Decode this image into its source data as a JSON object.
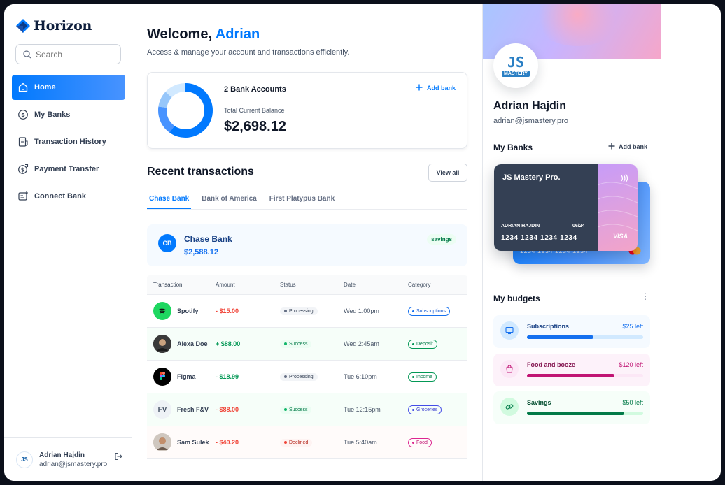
{
  "brand": {
    "name": "Horizon"
  },
  "search": {
    "placeholder": "Search"
  },
  "sidebar": {
    "items": [
      {
        "label": "Home",
        "icon": "home-icon"
      },
      {
        "label": "My Banks",
        "icon": "dollar-circle-icon"
      },
      {
        "label": "Transaction History",
        "icon": "receipt-icon"
      },
      {
        "label": "Payment Transfer",
        "icon": "money-send-icon"
      },
      {
        "label": "Connect Bank",
        "icon": "connect-bank-icon"
      }
    ],
    "user": {
      "name": "Adrian Hajdin",
      "email": "adrian@jsmastery.pro",
      "avatar_text": "JS"
    }
  },
  "header": {
    "greeting": "Welcome,",
    "name": "Adrian",
    "subtitle": "Access & manage your account and transactions efficiently."
  },
  "balance": {
    "accounts_label": "2 Bank Accounts",
    "total_label": "Total Current Balance",
    "total": "$2,698.12",
    "add_bank": "Add bank"
  },
  "recent": {
    "title": "Recent transactions",
    "view_all": "View all",
    "tabs": [
      "Chase Bank",
      "Bank of America",
      "First Platypus Bank"
    ],
    "active_bank": {
      "initials": "CB",
      "name": "Chase Bank",
      "balance": "$2,588.12",
      "type": "savings"
    },
    "columns": [
      "Transaction",
      "Amount",
      "Status",
      "Date",
      "Category"
    ],
    "rows": [
      {
        "name": "Spotify",
        "amount": "- $15.00",
        "status": "Processing",
        "date": "Wed 1:00pm",
        "category": "Subscriptions"
      },
      {
        "name": "Alexa Doe",
        "amount": "+ $88.00",
        "status": "Success",
        "date": "Wed 2:45am",
        "category": "Deposit"
      },
      {
        "name": "Figma",
        "amount": "- $18.99",
        "status": "Processing",
        "date": "Tue 6:10pm",
        "category": "Income"
      },
      {
        "name": "Fresh F&V",
        "initials": "FV",
        "amount": "- $88.00",
        "status": "Success",
        "date": "Tue 12:15pm",
        "category": "Groceries"
      },
      {
        "name": "Sam Sulek",
        "amount": "- $40.20",
        "status": "Declined",
        "date": "Tue 5:40am",
        "category": "Food"
      }
    ]
  },
  "profile": {
    "avatar_text": "JS",
    "avatar_subtext": "MASTERY",
    "name": "Adrian Hajdin",
    "email": "adrian@jsmastery.pro"
  },
  "my_banks": {
    "title": "My Banks",
    "add_bank": "Add bank",
    "card_front": {
      "title": "JS Mastery Pro.",
      "holder": "ADRIAN HAJDIN",
      "expiry": "06/24",
      "number": "1234 1234 1234 1234",
      "network": "VISA"
    },
    "card_back": {
      "number": "1234 1234 1234 1234"
    }
  },
  "budgets": {
    "title": "My budgets",
    "items": [
      {
        "name": "Subscriptions",
        "left": "$25 left",
        "progress": 0.57,
        "color": "#1570ef"
      },
      {
        "name": "Food and booze",
        "left": "$120 left",
        "progress": 0.75,
        "color": "#c11574"
      },
      {
        "name": "Savings",
        "left": "$50 left",
        "progress": 0.84,
        "color": "#027a48"
      }
    ]
  },
  "colors": {
    "accent": "#0179fe",
    "positive": "#039855",
    "negative": "#f04438"
  }
}
